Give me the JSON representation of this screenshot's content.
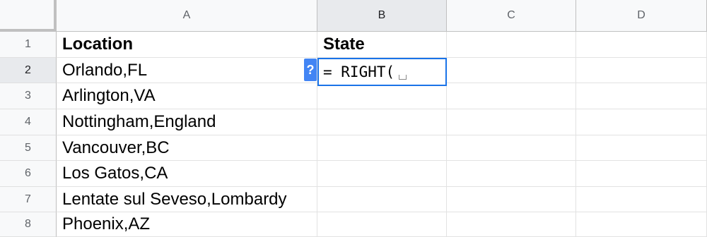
{
  "columns": [
    "A",
    "B",
    "C",
    "D"
  ],
  "rows": [
    "1",
    "2",
    "3",
    "4",
    "5",
    "6",
    "7",
    "8"
  ],
  "active": {
    "column": "B",
    "row": "2"
  },
  "cells": {
    "A": [
      "Location",
      "Orlando,FL",
      "Arlington,VA",
      "Nottingham,England",
      "Vancouver,BC",
      "Los Gatos,CA",
      "Lentate sul Seveso,Lombardy",
      "Phoenix,AZ"
    ],
    "B": [
      "State",
      "",
      "",
      "",
      "",
      "",
      "",
      ""
    ]
  },
  "formula_editor": {
    "text": "= RIGHT(",
    "help_label": "?"
  },
  "colors": {
    "accent": "#1a73e8",
    "help_badge": "#4285f4"
  }
}
